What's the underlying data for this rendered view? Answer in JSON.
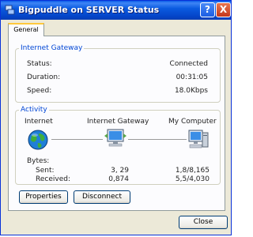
{
  "window": {
    "title": "Bigpuddle on SERVER Status",
    "help_label": "?",
    "close_label": "X"
  },
  "tabs": [
    {
      "label": "General"
    }
  ],
  "gateway": {
    "legend": "Internet Gateway",
    "rows": [
      {
        "label": "Status:",
        "value": "Connected"
      },
      {
        "label": "Duration:",
        "value": "00:31:05"
      },
      {
        "label": "Speed:",
        "value": "18.0Kbps"
      }
    ]
  },
  "activity": {
    "legend": "Activity",
    "nodes": [
      {
        "label": "Internet",
        "icon": "globe-icon"
      },
      {
        "label": "Internet Gateway",
        "icon": "gateway-computer-icon"
      },
      {
        "label": "My Computer",
        "icon": "my-computer-icon"
      }
    ],
    "bytes_label": "Bytes:",
    "sent_label": "Sent:",
    "received_label": "Received:",
    "gateway_sent": "3, 29",
    "gateway_received": "0,874",
    "computer_sent": "1,8/8,165",
    "computer_received": "5,5/4,030"
  },
  "buttons": {
    "properties": "Properties",
    "disconnect": "Disconnect",
    "close": "Close"
  }
}
